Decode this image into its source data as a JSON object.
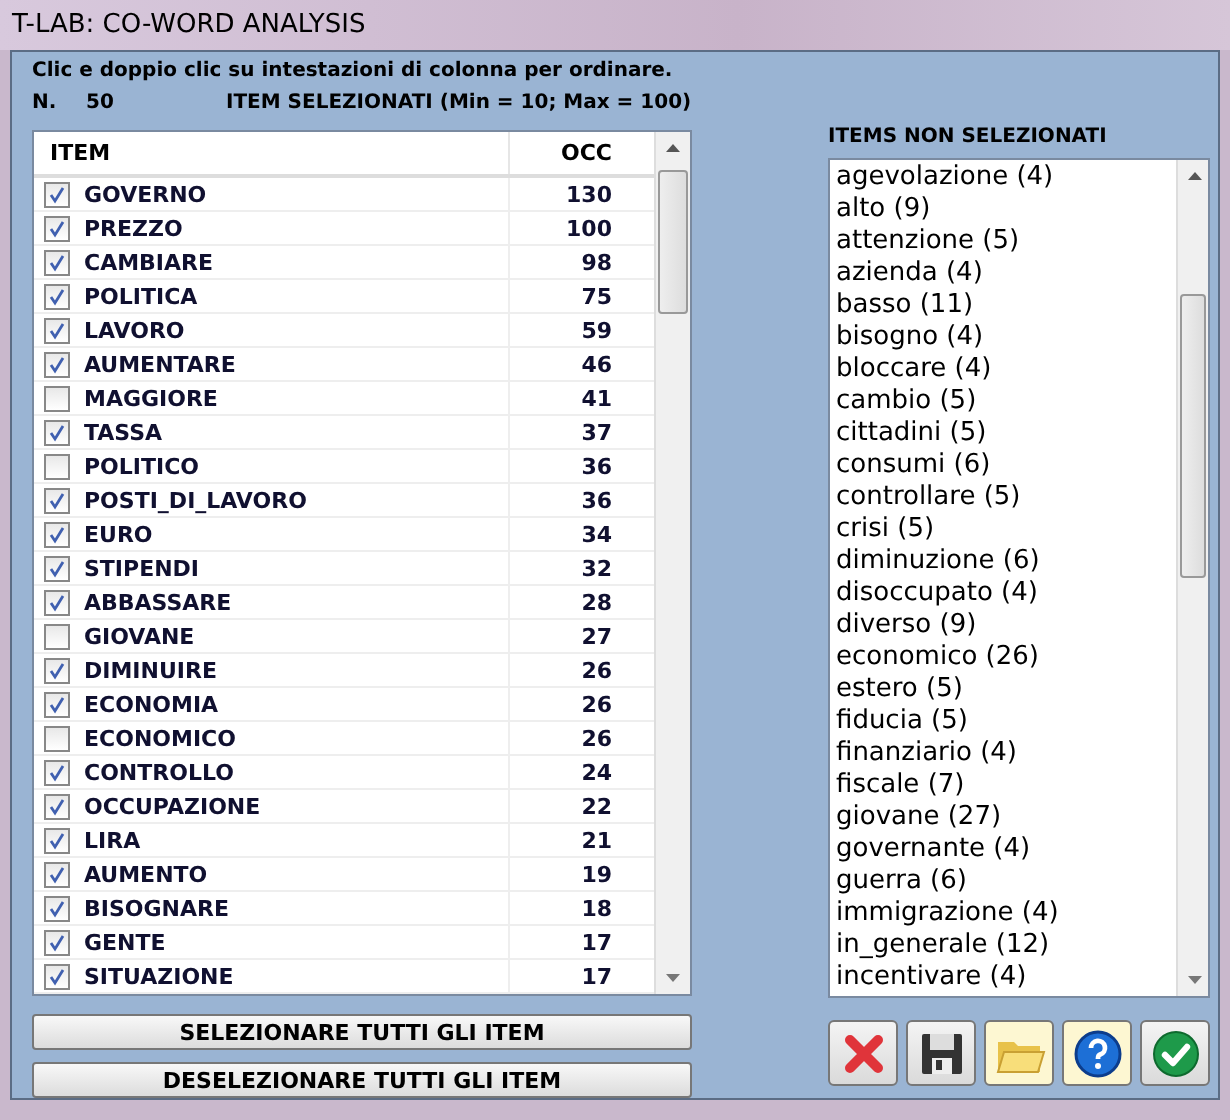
{
  "window": {
    "title": "T-LAB: CO-WORD ANALYSIS"
  },
  "hint": "Clic e doppio clic su intestazioni di colonna per ordinare.",
  "count": {
    "label": "N.",
    "value": "50",
    "caption": "ITEM SELEZIONATI (Min = 10; Max = 100)"
  },
  "table": {
    "columns": [
      "ITEM",
      "OCC"
    ],
    "rows": [
      {
        "item": "GOVERNO",
        "occ": "130",
        "checked": true
      },
      {
        "item": "PREZZO",
        "occ": "100",
        "checked": true
      },
      {
        "item": "CAMBIARE",
        "occ": "98",
        "checked": true
      },
      {
        "item": "POLITICA",
        "occ": "75",
        "checked": true
      },
      {
        "item": "LAVORO",
        "occ": "59",
        "checked": true
      },
      {
        "item": "AUMENTARE",
        "occ": "46",
        "checked": true
      },
      {
        "item": "MAGGIORE",
        "occ": "41",
        "checked": false
      },
      {
        "item": "TASSA",
        "occ": "37",
        "checked": true
      },
      {
        "item": "POLITICO",
        "occ": "36",
        "checked": false
      },
      {
        "item": "POSTI_DI_LAVORO",
        "occ": "36",
        "checked": true
      },
      {
        "item": "EURO",
        "occ": "34",
        "checked": true
      },
      {
        "item": "STIPENDI",
        "occ": "32",
        "checked": true
      },
      {
        "item": "ABBASSARE",
        "occ": "28",
        "checked": true
      },
      {
        "item": "GIOVANE",
        "occ": "27",
        "checked": false
      },
      {
        "item": "DIMINUIRE",
        "occ": "26",
        "checked": true
      },
      {
        "item": "ECONOMIA",
        "occ": "26",
        "checked": true
      },
      {
        "item": "ECONOMICO",
        "occ": "26",
        "checked": false
      },
      {
        "item": "CONTROLLO",
        "occ": "24",
        "checked": true
      },
      {
        "item": "OCCUPAZIONE",
        "occ": "22",
        "checked": true
      },
      {
        "item": "LIRA",
        "occ": "21",
        "checked": true
      },
      {
        "item": "AUMENTO",
        "occ": "19",
        "checked": true
      },
      {
        "item": "BISOGNARE",
        "occ": "18",
        "checked": true
      },
      {
        "item": "GENTE",
        "occ": "17",
        "checked": true
      },
      {
        "item": "SITUAZIONE",
        "occ": "17",
        "checked": true
      }
    ]
  },
  "buttons": [
    "SELEZIONARE TUTTI GLI ITEM",
    "DESELEZIONARE TUTTI GLI ITEM"
  ],
  "unselected": {
    "title": "ITEMS NON SELEZIONATI",
    "items": [
      "agevolazione (4)",
      "alto (9)",
      "attenzione (5)",
      "azienda (4)",
      "basso (11)",
      "bisogno (4)",
      "bloccare (4)",
      "cambio (5)",
      "cittadini (5)",
      "consumi (6)",
      "controllare (5)",
      "crisi (5)",
      "diminuzione (6)",
      "disoccupato (4)",
      "diverso (9)",
      "economico (26)",
      "estero (5)",
      "fiducia (5)",
      "finanziario (4)",
      "fiscale (7)",
      "giovane (27)",
      "governante (4)",
      "guerra (6)",
      "immigrazione (4)",
      "in_generale (12)",
      "incentivare (4)"
    ]
  },
  "toolbar": [
    {
      "kind": "cancel"
    },
    {
      "kind": "save"
    },
    {
      "kind": "open"
    },
    {
      "kind": "help"
    },
    {
      "kind": "ok"
    }
  ]
}
